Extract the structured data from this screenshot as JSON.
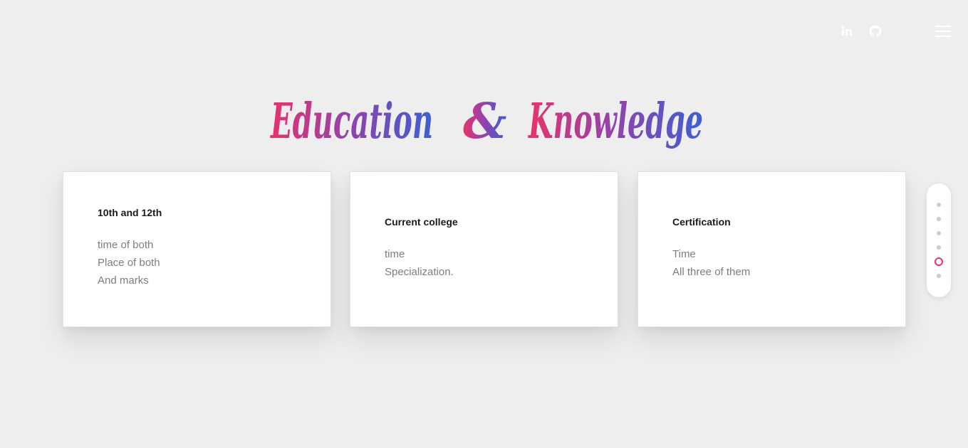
{
  "header": {
    "social": [
      {
        "icon": "linkedin-icon",
        "label": "in"
      },
      {
        "icon": "github-icon"
      }
    ],
    "menu_icon": "hamburger-menu-icon"
  },
  "section": {
    "title_word1": "Education",
    "title_amp": "&",
    "title_word2": "Knowledge",
    "gradient": [
      "#e8336d",
      "#8e44ad",
      "#3d5fd1"
    ]
  },
  "cards": [
    {
      "heading": "10th and 12th",
      "lines": [
        "time of both",
        "Place of both",
        "And marks"
      ]
    },
    {
      "heading": "Current college",
      "lines": [
        "time",
        "Specialization."
      ]
    },
    {
      "heading": "Certification",
      "lines": [
        "Time",
        "All three of them"
      ]
    }
  ],
  "pager": {
    "count": 6,
    "active_index": 4,
    "active_color": "#e8336d"
  }
}
